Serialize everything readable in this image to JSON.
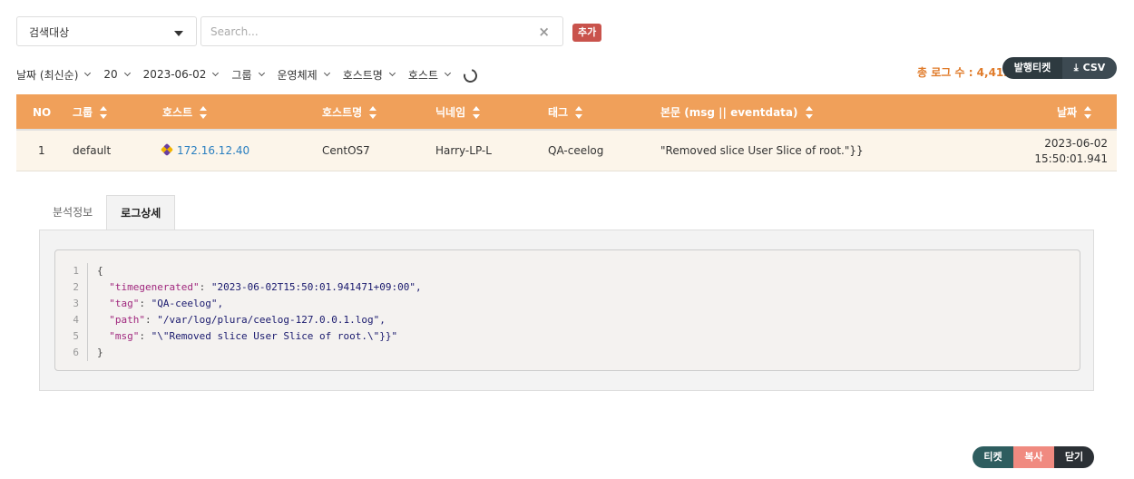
{
  "search": {
    "target_label": "검색대상",
    "placeholder": "Search...",
    "clear_icon": "×",
    "add_label": "추가"
  },
  "filters": [
    {
      "label": "날짜 (최신순)"
    },
    {
      "label": "20"
    },
    {
      "label": "2023-06-02"
    },
    {
      "label": "그룹"
    },
    {
      "label": "운영체제"
    },
    {
      "label": "호스트명"
    },
    {
      "label": "호스트"
    }
  ],
  "summary": {
    "total_label": "총 로그 수 : 4,412",
    "ticket_label": "발행티켓",
    "csv_label": "CSV"
  },
  "table": {
    "headers": [
      "NO",
      "그룹",
      "호스트",
      "호스트명",
      "닉네임",
      "태그",
      "본문 (msg || eventdata)",
      "날짜"
    ],
    "rows": [
      {
        "no": "1",
        "group": "default",
        "host": "172.16.12.40",
        "hostname": "CentOS7",
        "nickname": "Harry-LP-L",
        "tag": "QA-ceelog",
        "message": "\"Removed slice User Slice of root.\"}}",
        "date": "2023-06-02",
        "time": "15:50:01.941"
      }
    ]
  },
  "tabs": [
    "분석정보",
    "로그상세"
  ],
  "log_detail": {
    "line_numbers": [
      "1",
      "2",
      "3",
      "4",
      "5",
      "6"
    ],
    "open": "{",
    "close": "}",
    "fields": [
      {
        "key": "\"timegenerated\"",
        "value": "\"2023-06-02T15:50:01.941471+09:00\","
      },
      {
        "key": "\"tag\"",
        "value": "\"QA-ceelog\","
      },
      {
        "key": "\"path\"",
        "value": "\"/var/log/plura/ceelog-127.0.0.1.log\","
      },
      {
        "key": "\"msg\"",
        "value": "\"\\\"Removed slice User Slice of root.\\\"}}\""
      }
    ]
  },
  "actions": {
    "ticket_label": "티켓",
    "copy_label": "복사",
    "close_label": "닫기"
  }
}
